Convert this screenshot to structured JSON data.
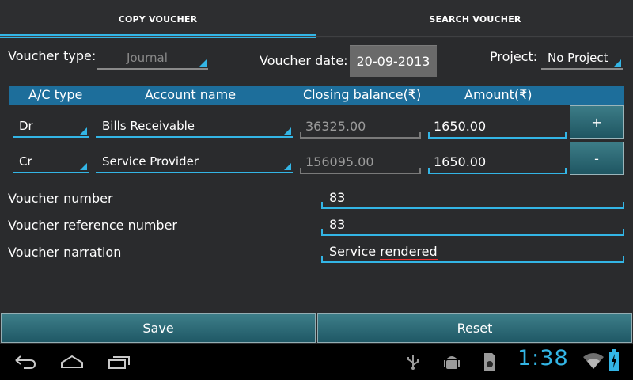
{
  "tabs": [
    {
      "label": "COPY VOUCHER",
      "active": true
    },
    {
      "label": "SEARCH VOUCHER",
      "active": false
    }
  ],
  "form": {
    "voucher_type_label": "Voucher type:",
    "voucher_type_value": "Journal",
    "voucher_date_label": "Voucher date:",
    "voucher_date_value": "20-09-2013",
    "project_label": "Project:",
    "project_value": "No Project"
  },
  "table": {
    "headers": [
      "A/C type",
      "Account name",
      "Closing balance(₹)",
      "Amount(₹)"
    ],
    "rows": [
      {
        "ac_type": "Dr",
        "account": "Bills Receivable",
        "closing": "36325.00",
        "amount": "1650.00",
        "button": "+"
      },
      {
        "ac_type": "Cr",
        "account": "Service Provider",
        "closing": "156095.00",
        "amount": "1650.00",
        "button": "-"
      }
    ]
  },
  "fields": {
    "number_label": "Voucher number",
    "number_value": "83",
    "reference_label": "Voucher reference number",
    "reference_value": "83",
    "narration_label": "Voucher narration",
    "narration_value_1": "Service ",
    "narration_value_2": "rendered"
  },
  "actions": {
    "save": "Save",
    "reset": "Reset"
  },
  "statusbar": {
    "time": "1:38",
    "icons": [
      "back-icon",
      "home-icon",
      "recent-apps-icon",
      "usb-icon",
      "android-debug-icon",
      "sd-card-icon",
      "wifi-icon",
      "battery-charging-icon"
    ]
  },
  "colors": {
    "accent": "#33b5e5",
    "header_bg": "#1d6e9b",
    "background": "#2a2b2d"
  }
}
